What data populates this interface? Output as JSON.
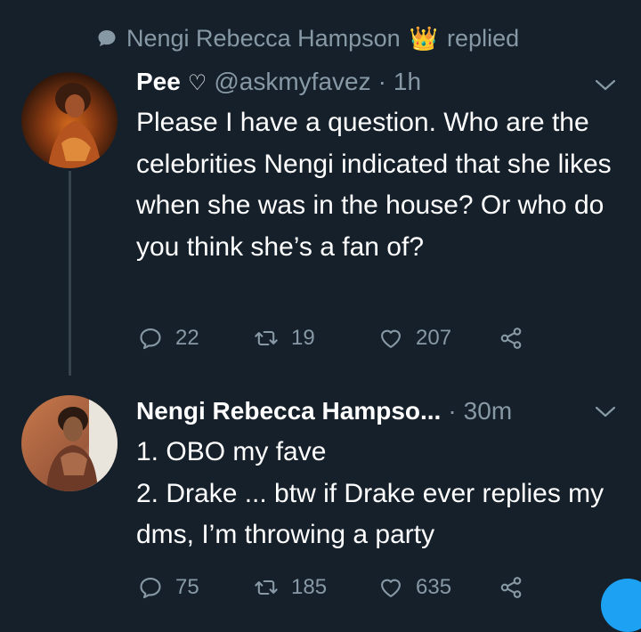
{
  "context": {
    "icon": "speech-bubble-icon",
    "replier": "Nengi Rebecca Hampson",
    "badge": "👑",
    "action": "replied"
  },
  "tweet1": {
    "name": "Pee",
    "name_suffix": "♡",
    "handle": "@askmyfavez",
    "separator": "·",
    "time": "1h",
    "text": "Please I have a question. Who are the celebrities Nengi indicated that she likes when she was in the house? Or who do you think she’s a fan of?",
    "replies": "22",
    "retweets": "19",
    "likes": "207"
  },
  "tweet2": {
    "name": "Nengi Rebecca Hampso...",
    "separator": "·",
    "time": "30m",
    "lines": [
      "1. OBO my fave",
      "2. Drake ... btw if Drake ever replies my dms, I’m throwing a party"
    ],
    "replies": "75",
    "retweets": "185",
    "likes": "635"
  },
  "colors": {
    "background": "#15202b",
    "text": "#ffffff",
    "muted": "#8899a6",
    "thread_line": "#38444d",
    "accent": "#1da1f2"
  }
}
